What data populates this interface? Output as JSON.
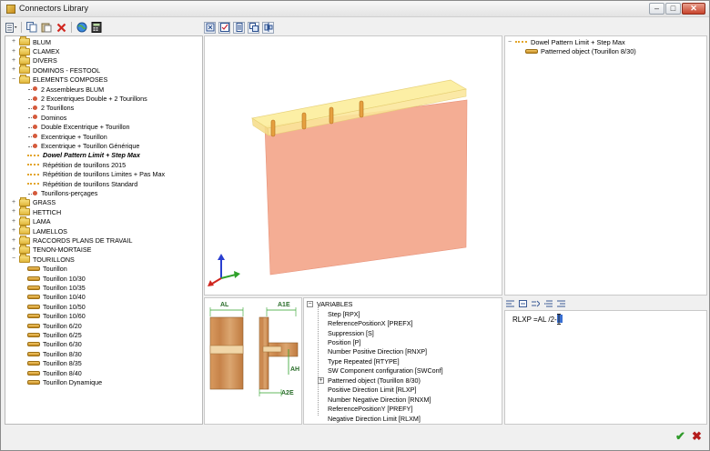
{
  "window": {
    "title": "Connectors Library",
    "controls": {
      "minimize": "–",
      "maximize": "□",
      "close": "✕"
    }
  },
  "tree": {
    "items": [
      {
        "label": "BLUM",
        "kind": "folder",
        "expander": "+"
      },
      {
        "label": "CLAMEX",
        "kind": "folder",
        "expander": "+"
      },
      {
        "label": "DIVERS",
        "kind": "folder",
        "expander": "+"
      },
      {
        "label": "DOMINOS - FESTOOL",
        "kind": "folder",
        "expander": "+"
      },
      {
        "label": "ELEMENTS COMPOSES",
        "kind": "folder",
        "expander": "−"
      },
      {
        "label": "2 Assembleurs BLUM",
        "kind": "connector"
      },
      {
        "label": "2 Excentriques Double + 2 Tourillons",
        "kind": "connector"
      },
      {
        "label": "2 Tourillons",
        "kind": "connector"
      },
      {
        "label": "Dominos",
        "kind": "connector"
      },
      {
        "label": "Double Excentrique + Tourillon",
        "kind": "connector"
      },
      {
        "label": "Excentrique + Tourillon",
        "kind": "connector"
      },
      {
        "label": "Excentrique + Tourillon Générique",
        "kind": "connector"
      },
      {
        "label": "Dowel Pattern Limit + Step Max",
        "kind": "pattern",
        "selected": true
      },
      {
        "label": "Répétition de tourillons 2015",
        "kind": "pattern"
      },
      {
        "label": "Répétition de tourillons Limites + Pas Max",
        "kind": "pattern"
      },
      {
        "label": "Répétition de tourillons Standard",
        "kind": "pattern"
      },
      {
        "label": "Tourillons-perçages",
        "kind": "connector"
      },
      {
        "label": "GRASS",
        "kind": "folder",
        "expander": "+"
      },
      {
        "label": "HETTICH",
        "kind": "folder",
        "expander": "+"
      },
      {
        "label": "LAMA",
        "kind": "folder",
        "expander": "+"
      },
      {
        "label": "LAMELLOS",
        "kind": "folder",
        "expander": "+"
      },
      {
        "label": "RACCORDS PLANS DE TRAVAIL",
        "kind": "folder",
        "expander": "+"
      },
      {
        "label": "TENON-MORTAISE",
        "kind": "folder",
        "expander": "+"
      },
      {
        "label": "TOURILLONS",
        "kind": "folder",
        "expander": "−"
      },
      {
        "label": "Tourillon",
        "kind": "dowel"
      },
      {
        "label": "Tourillon 10/30",
        "kind": "dowel"
      },
      {
        "label": "Tourillon 10/35",
        "kind": "dowel"
      },
      {
        "label": "Tourillon 10/40",
        "kind": "dowel"
      },
      {
        "label": "Tourillon 10/50",
        "kind": "dowel"
      },
      {
        "label": "Tourillon 10/60",
        "kind": "dowel"
      },
      {
        "label": "Tourillon 6/20",
        "kind": "dowel"
      },
      {
        "label": "Tourillon 6/25",
        "kind": "dowel"
      },
      {
        "label": "Tourillon 6/30",
        "kind": "dowel"
      },
      {
        "label": "Tourillon 8/30",
        "kind": "dowel"
      },
      {
        "label": "Tourillon 8/35",
        "kind": "dowel"
      },
      {
        "label": "Tourillon 8/40",
        "kind": "dowel"
      },
      {
        "label": "Tourillon Dynamique",
        "kind": "dowel"
      }
    ]
  },
  "structure_tree": {
    "root": "Dowel Pattern Limit + Step Max",
    "child": "Patterned object (Tourillon 8/30)"
  },
  "diagram": {
    "labels": {
      "al": "AL",
      "a1e": "A1E",
      "ah": "AH",
      "a2e": "A2E"
    }
  },
  "variables": {
    "root_label": "VARIABLES",
    "root_expander": "−",
    "items": [
      {
        "label": "Step [RPX]"
      },
      {
        "label": "ReferencePositionX [PREFX]"
      },
      {
        "label": "Suppression [S]"
      },
      {
        "label": "Position [P]"
      },
      {
        "label": "Number Positive Direction [RNXP]"
      },
      {
        "label": "Type Repeated [RTYPE]"
      },
      {
        "label": "SW Component configuration [SWConf]"
      },
      {
        "label": "Patterned object (Tourillon 8/30)",
        "expander": "+"
      },
      {
        "label": "Positive Direction Limit [RLXP]"
      },
      {
        "label": "Number Negative Direction [RNXM]"
      },
      {
        "label": "ReferencePositionY [PREFY]"
      },
      {
        "label": "Negative Direction Limit [RLXM]"
      }
    ]
  },
  "formula": {
    "text": "RLXP =AL /2-"
  },
  "buttons": {
    "ok": "✔",
    "cancel": "✖"
  },
  "colors": {
    "panel": "#f4ad94",
    "board": "#fce69b",
    "dowel": "#e6a040",
    "accent": "#3a6fd1"
  }
}
